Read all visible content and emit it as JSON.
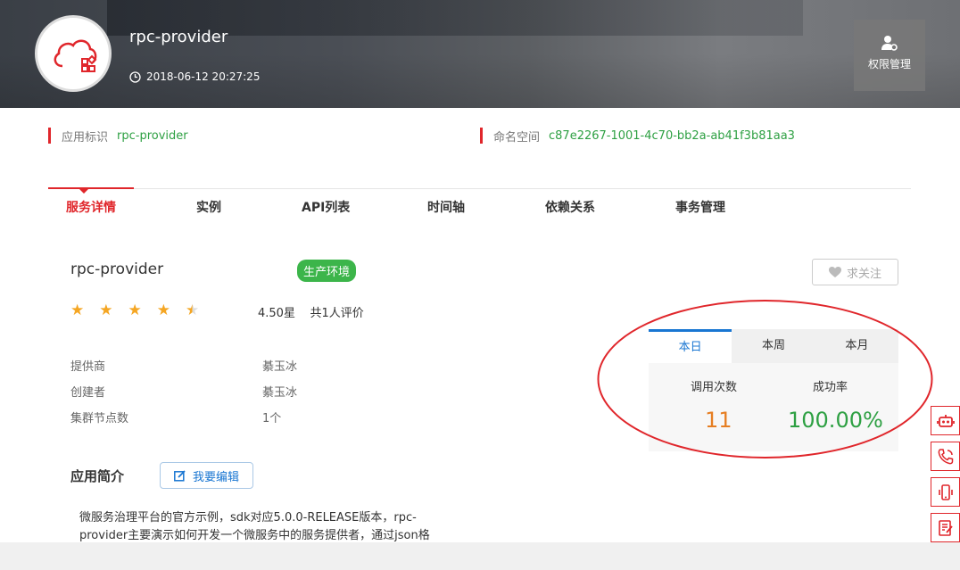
{
  "header": {
    "app_title": "rpc-provider",
    "timestamp": "2018-06-12 20:27:25",
    "permission_button": "权限管理"
  },
  "info": {
    "app_id_label": "应用标识",
    "app_id_value": "rpc-provider",
    "namespace_label": "命名空间",
    "namespace_value": "c87e2267-1001-4c70-bb2a-ab41f3b81aa3"
  },
  "tabs": [
    {
      "label": "服务详情",
      "active": true
    },
    {
      "label": "实例"
    },
    {
      "label": "API列表"
    },
    {
      "label": "时间轴"
    },
    {
      "label": "依赖关系"
    },
    {
      "label": "事务管理"
    }
  ],
  "detail": {
    "service_name": "rpc-provider",
    "env_badge": "生产环境",
    "follow_button": "求关注",
    "rating_value": 4.5,
    "rating_text": "4.50星",
    "review_count": "共1人评价",
    "fields": [
      {
        "label": "提供商",
        "value": "綦玉冰"
      },
      {
        "label": "创建者",
        "value": "綦玉冰"
      },
      {
        "label": "集群节点数",
        "value": "1个"
      }
    ],
    "intro_title": "应用简介",
    "edit_button": "我要编辑",
    "intro_text": "微服务治理平台的官方示例，sdk对应5.0.0-RELEASE版本，rpc-provider主要演示如何开发一个微服务中的服务提供者，通过json格"
  },
  "stats": {
    "tabs": [
      "本日",
      "本周",
      "本月"
    ],
    "active_tab": "本日",
    "calls_label": "调用次数",
    "success_label": "成功率",
    "calls_value": "11",
    "success_value": "100.00%"
  },
  "colors": {
    "accent_red": "#e0262b",
    "green": "#2ea043",
    "blue": "#1976d2",
    "orange": "#e67e22"
  },
  "side_buttons": [
    "robot-icon",
    "phone-icon",
    "mobile-icon",
    "notes-icon"
  ]
}
